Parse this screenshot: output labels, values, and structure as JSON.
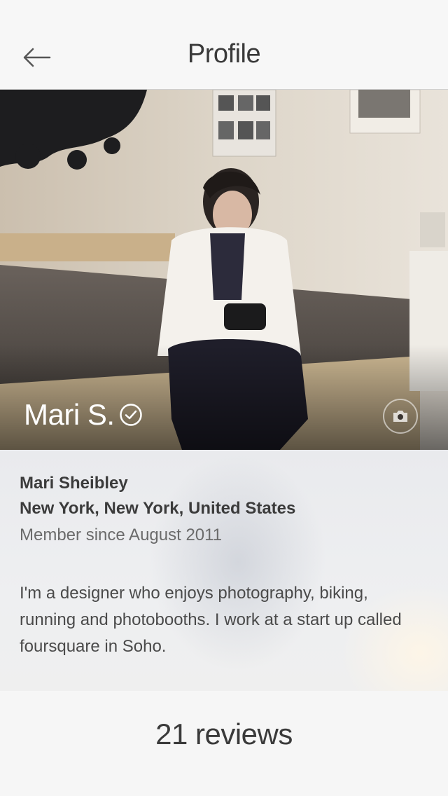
{
  "navbar": {
    "title": "Profile",
    "back_icon": "back-arrow-icon"
  },
  "hero": {
    "display_name": "Mari S.",
    "verified_icon": "verified-check-icon",
    "camera_icon": "camera-icon"
  },
  "profile": {
    "full_name": "Mari Sheibley",
    "location": "New York, New York, United States",
    "member_since": "Member since August 2011",
    "bio": "I'm a designer who enjoys photography, biking, running and photobooths. I work at a start up called foursquare in Soho."
  },
  "reviews": {
    "label": "21 reviews"
  }
}
